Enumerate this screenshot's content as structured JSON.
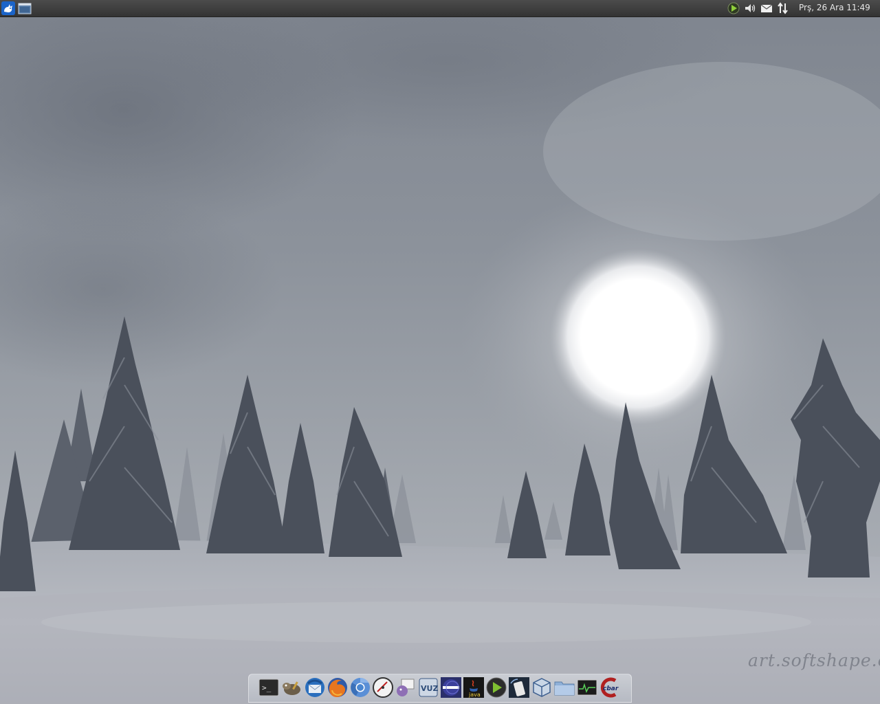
{
  "top_panel": {
    "menu_icon": "xfce-mouse-icon",
    "desktop_icon": "show-desktop-icon",
    "tray": [
      {
        "name": "media-player-icon"
      },
      {
        "name": "volume-icon"
      },
      {
        "name": "mail-icon"
      },
      {
        "name": "network-icon"
      }
    ],
    "clock": "Prş, 26 Ara  11:49"
  },
  "wallpaper": {
    "watermark": "art.softshape.co"
  },
  "dock": {
    "items": [
      {
        "name": "terminal-icon"
      },
      {
        "name": "gimp-icon"
      },
      {
        "name": "thunderbird-icon"
      },
      {
        "name": "firefox-icon"
      },
      {
        "name": "chromium-icon"
      },
      {
        "name": "speedometer-icon"
      },
      {
        "name": "pidgin-icon"
      },
      {
        "name": "vuze-icon"
      },
      {
        "name": "eclipse-icon"
      },
      {
        "name": "java-icon"
      },
      {
        "name": "media-player-icon"
      },
      {
        "name": "phone-icon"
      },
      {
        "name": "virtualbox-icon"
      },
      {
        "name": "file-manager-icon"
      },
      {
        "name": "system-monitor-icon"
      },
      {
        "name": "cbar-icon"
      }
    ],
    "cbar_label": "cbar",
    "java_label": "java",
    "vuze_label": "VUZ",
    "terminal_prompt": ">_"
  },
  "colors": {
    "panel": "#3c3c3c",
    "sky": "#9aa0a8",
    "snow": "#b9bcc4",
    "tree": "#4a505b",
    "sun": "#ffffff"
  }
}
